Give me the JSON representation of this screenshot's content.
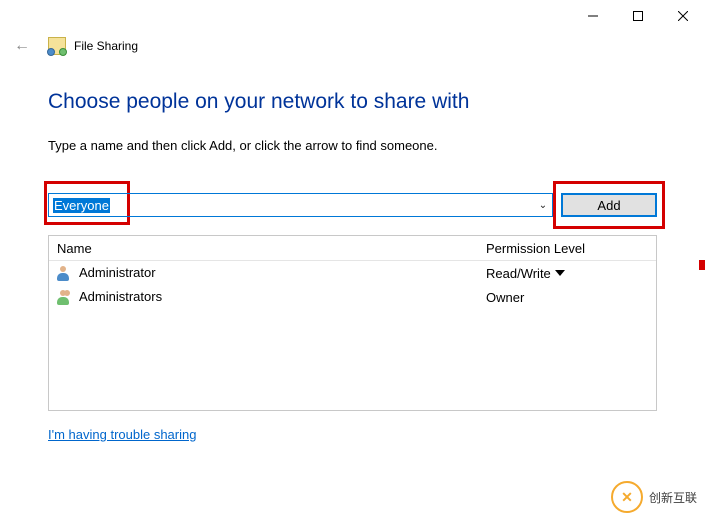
{
  "window": {
    "title": "File Sharing"
  },
  "page": {
    "heading": "Choose people on your network to share with",
    "subtext": "Type a name and then click Add, or click the arrow to find someone."
  },
  "input": {
    "value": "Everyone",
    "add_label": "Add"
  },
  "list": {
    "columns": {
      "name": "Name",
      "perm": "Permission Level"
    },
    "rows": [
      {
        "name": "Administrator",
        "perm": "Read/Write",
        "icon": "single",
        "perm_dropdown": true
      },
      {
        "name": "Administrators",
        "perm": "Owner",
        "icon": "group",
        "perm_dropdown": false
      }
    ]
  },
  "footer": {
    "trouble_link": "I'm having trouble sharing"
  },
  "watermark": {
    "text": "创新互联"
  }
}
